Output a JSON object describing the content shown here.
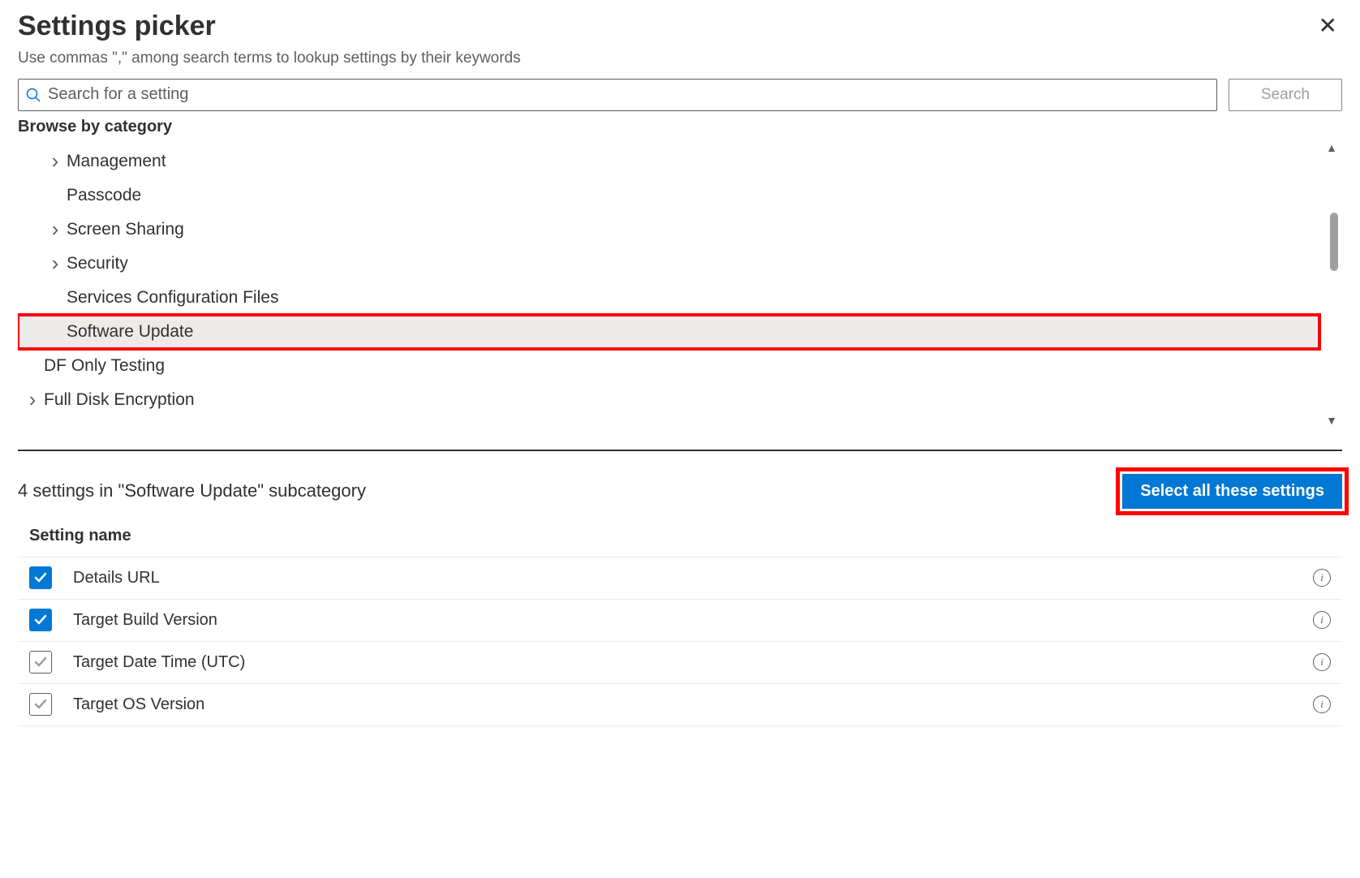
{
  "header": {
    "title": "Settings picker",
    "subtitle": "Use commas \",\" among search terms to lookup settings by their keywords"
  },
  "search": {
    "placeholder": "Search for a setting",
    "button_label": "Search"
  },
  "browse_label": "Browse by category",
  "categories": [
    {
      "label": "Management",
      "has_children": true,
      "indent": 1,
      "selected": false
    },
    {
      "label": "Passcode",
      "has_children": false,
      "indent": 1,
      "selected": false
    },
    {
      "label": "Screen Sharing",
      "has_children": true,
      "indent": 1,
      "selected": false
    },
    {
      "label": "Security",
      "has_children": true,
      "indent": 1,
      "selected": false
    },
    {
      "label": "Services Configuration Files",
      "has_children": false,
      "indent": 1,
      "selected": false
    },
    {
      "label": "Software Update",
      "has_children": false,
      "indent": 1,
      "selected": true
    },
    {
      "label": "DF Only Testing",
      "has_children": false,
      "indent": 0,
      "selected": false
    },
    {
      "label": "Full Disk Encryption",
      "has_children": true,
      "indent": 0,
      "selected": false
    }
  ],
  "subcategory_summary": "4 settings in \"Software Update\" subcategory",
  "select_all_label": "Select all these settings",
  "table": {
    "header": "Setting name",
    "rows": [
      {
        "name": "Details URL",
        "checked": true
      },
      {
        "name": "Target Build Version",
        "checked": true
      },
      {
        "name": "Target Date Time (UTC)",
        "checked": false
      },
      {
        "name": "Target OS Version",
        "checked": false
      }
    ]
  }
}
